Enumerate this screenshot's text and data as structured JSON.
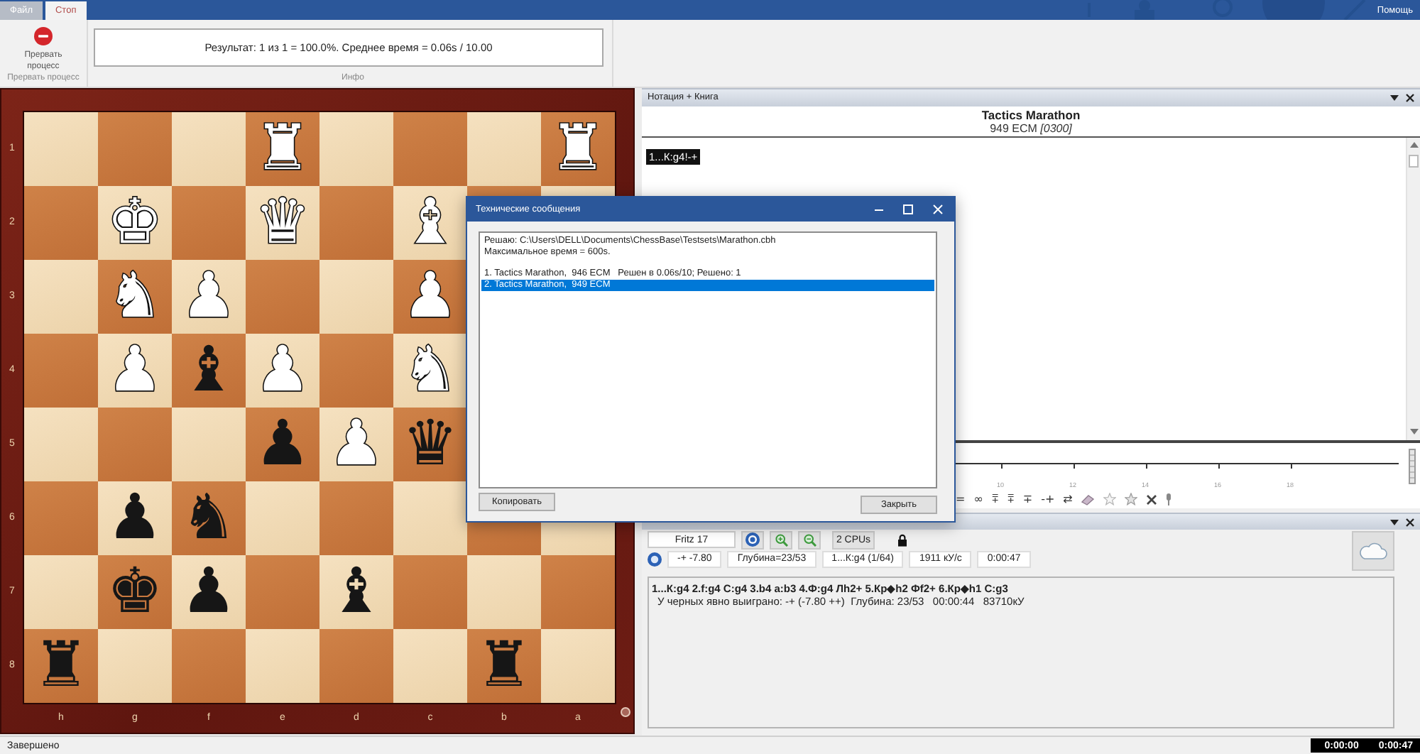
{
  "menu_bar": {
    "tabs": [
      {
        "label": "Файл",
        "selected": false
      },
      {
        "label": "Стоп",
        "selected": true
      }
    ],
    "help": "Помощь"
  },
  "ribbon": {
    "stop_button": "Прервать процесс",
    "stop_group_label": "Прервать процесс",
    "info_text": "Результат: 1 из 1 = 100.0%. Среднее время = 0.06s / 10.00",
    "info_group_label": "Инфо"
  },
  "board": {
    "ranks": [
      "1",
      "2",
      "3",
      "4",
      "5",
      "6",
      "7",
      "8"
    ],
    "files": [
      "h",
      "g",
      "f",
      "e",
      "d",
      "c",
      "b",
      "a"
    ],
    "rows": [
      [
        null,
        null,
        null,
        {
          "glyph": "♜",
          "white": true
        },
        null,
        null,
        null,
        {
          "glyph": "♜",
          "white": true
        }
      ],
      [
        null,
        {
          "glyph": "♚",
          "white": true
        },
        null,
        {
          "glyph": "♛",
          "white": true
        },
        null,
        {
          "glyph": "♝",
          "white": true
        },
        null,
        null
      ],
      [
        null,
        {
          "glyph": "♞",
          "white": true
        },
        {
          "glyph": "♟",
          "white": true
        },
        null,
        null,
        {
          "glyph": "♟",
          "white": true
        },
        null,
        null
      ],
      [
        null,
        {
          "glyph": "♟",
          "white": true
        },
        {
          "glyph": "♝",
          "white": false
        },
        {
          "glyph": "♟",
          "white": true
        },
        null,
        {
          "glyph": "♞",
          "white": true
        },
        null,
        null
      ],
      [
        null,
        null,
        null,
        {
          "glyph": "♟",
          "white": false
        },
        {
          "glyph": "♟",
          "white": true
        },
        {
          "glyph": "♛",
          "white": false
        },
        null,
        null
      ],
      [
        null,
        {
          "glyph": "♟",
          "white": false
        },
        {
          "glyph": "♞",
          "white": false
        },
        null,
        null,
        null,
        null,
        null
      ],
      [
        null,
        {
          "glyph": "♚",
          "white": false
        },
        {
          "glyph": "♟",
          "white": false
        },
        null,
        {
          "glyph": "♝",
          "white": false
        },
        null,
        null,
        null
      ],
      [
        {
          "glyph": "♜",
          "white": false
        },
        null,
        null,
        null,
        null,
        null,
        {
          "glyph": "♜",
          "white": false
        },
        null
      ]
    ]
  },
  "notation_panel": {
    "title": "Нотация + Книга",
    "game_title": "Tactics Marathon",
    "game_subtitle": "949 ECM *[0300]*",
    "moves": [
      {
        "text": "1...К:g4!-+",
        "selected": true
      }
    ]
  },
  "evaluation_graph": {
    "tick_labels": [
      "10",
      "12",
      "14",
      "16",
      "18"
    ]
  },
  "annotation_toolbar": {
    "symbols": [
      "=",
      "∞",
      "⩱",
      "⩱",
      "∓",
      "-+",
      "⇄"
    ]
  },
  "engine_panel": {
    "engine_name": "Fritz 17",
    "cpus": "2 CPUs",
    "readouts": [
      "-+ -7.80",
      "Глубина=23/53",
      "1...К:g4 (1/64)",
      "1911 кУ/с",
      "0:00:47"
    ],
    "lines": [
      {
        "kind": "main",
        "text": "1...К:g4 2.f:g4 С:g4 3.b4 a:b3 4.Ф:g4 Лh2+ 5.Кр◆h2 Фf2+ 6.Кр◆h1 С:g3"
      },
      {
        "kind": "info",
        "text": "У черных явно выиграно: -+ (-7.80 ++)  Глубина: 23/53   00:00:44   83710кУ"
      }
    ]
  },
  "status_bar": {
    "text": "Завершено",
    "clocks": [
      "0:00:00",
      "0:00:47"
    ]
  },
  "dialog": {
    "title": "Технические сообщения",
    "header_lines": [
      "Решаю: C:\\Users\\DELL\\Documents\\ChessBase\\Testsets\\Marathon.cbh",
      "Максимальное время = 600s."
    ],
    "results": [
      {
        "text": "1. Tactics Marathon,  946 ECM   Решен в 0.06s/10; Решено: 1",
        "selected": false
      },
      {
        "text": "2. Tactics Marathon,  949 ECM",
        "selected": true
      }
    ],
    "buttons": [
      "Копировать",
      "Закрыть"
    ]
  }
}
